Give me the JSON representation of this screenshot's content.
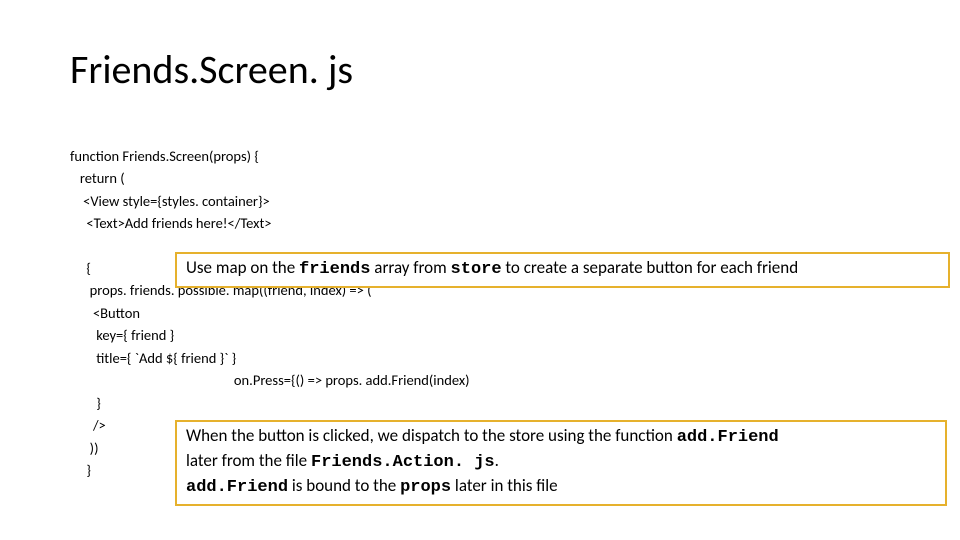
{
  "title": "Friends.Screen. js",
  "code": {
    "l1": "function Friends.Screen(props) {",
    "l2": "   return (",
    "l3": "    <View style={styles. container}>",
    "l4": "     <Text>Add friends here!</Text>",
    "l5_pre": "     {",
    "l6": "      props. friends. possible. map((friend, index) => (",
    "l7": "       <Button",
    "l8": "        key={ friend }",
    "l9": "        title={ `Add ${ friend }` }",
    "l10": "                                                  on.Press={() => props. add.Friend(index)",
    "l11": "        }",
    "l12": "       />",
    "l13": "      ))",
    "l14": "     }"
  },
  "callout1": {
    "t1": "Use map on the ",
    "b1": "friends",
    "t2": " array from ",
    "b2": "store",
    "t3": " to create a separate button for each friend"
  },
  "callout2": {
    "l1a": "When the button is clicked, we dispatch to the store using the function ",
    "l1b": "add.Friend",
    "l2a": "later from the file ",
    "l2b": "Friends.Action. js",
    "l2c": ".",
    "l3a": "add.Friend",
    "l3b": " is bound to the ",
    "l3c": "props",
    "l3d": " later in this file"
  }
}
